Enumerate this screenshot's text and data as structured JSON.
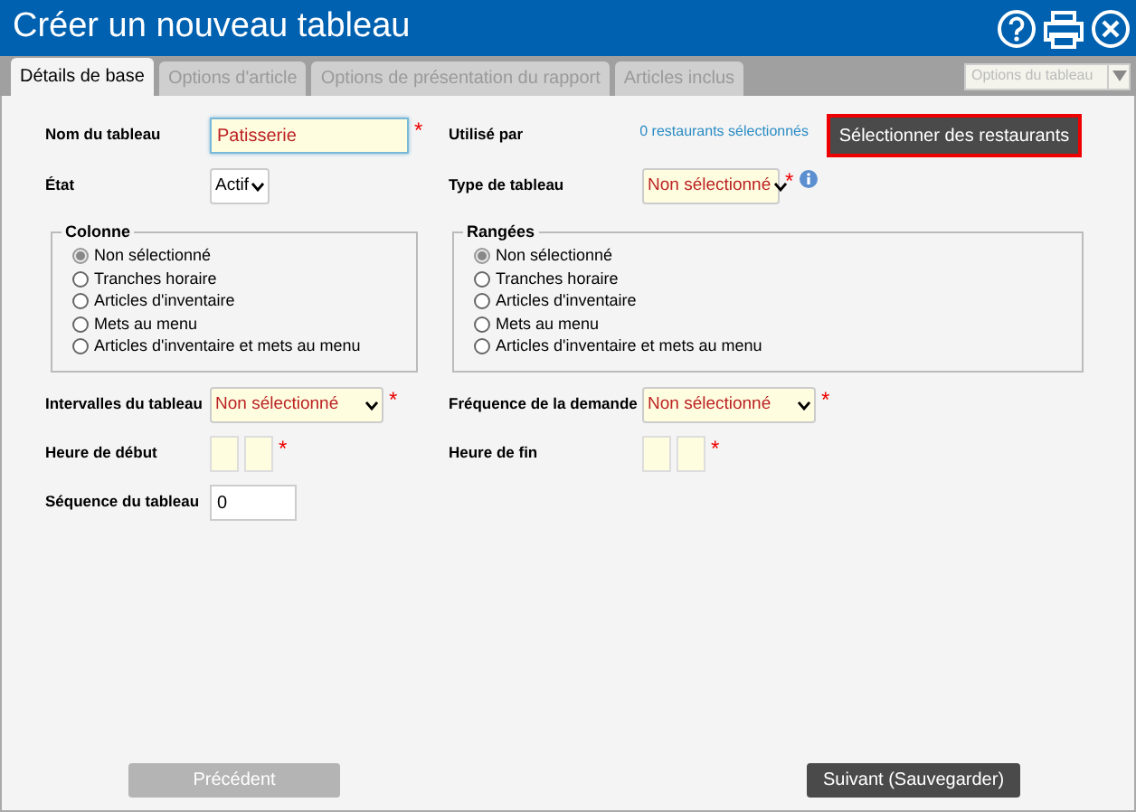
{
  "window": {
    "title": "Créer un nouveau tableau"
  },
  "tabs": [
    {
      "label": "Détails de base",
      "selected": true
    },
    {
      "label": "Options d'article",
      "selected": false
    },
    {
      "label": "Options de présentation du rapport",
      "selected": false
    },
    {
      "label": "Articles inclus",
      "selected": false
    }
  ],
  "tab_dropdown": {
    "value": "Options du tableau",
    "disabled": true
  },
  "top_rows": [
    {
      "left": {
        "label": "Nom du tableau",
        "kind": "text",
        "value": "Patisserie",
        "highlighted": true,
        "required_mark": "*"
      },
      "right": {
        "label": "Utilisé par",
        "kind": "link_button",
        "link": "0 restaurants sélectionnés",
        "button": "Sélectionner des restaurants"
      }
    },
    {
      "left": {
        "label": "État",
        "kind": "select",
        "value": "Actif",
        "highlighted": false
      },
      "right": {
        "label": "Type de tableau",
        "kind": "select",
        "value": "Non sélectionné",
        "highlighted": true,
        "required_mark": "*",
        "info": true
      }
    }
  ],
  "groups": [
    {
      "legend": "Colonne",
      "options": [
        {
          "label": "Non sélectionné",
          "selected": true
        },
        {
          "label": "Tranches horaire",
          "selected": false
        },
        {
          "label": "Articles d'inventaire",
          "selected": false
        },
        {
          "label": "Mets au menu",
          "selected": false
        },
        {
          "label": "Articles d'inventaire et mets au menu",
          "selected": false
        }
      ]
    },
    {
      "legend": "Rangées",
      "options": [
        {
          "label": "Non sélectionné",
          "selected": true
        },
        {
          "label": "Tranches horaire",
          "selected": false
        },
        {
          "label": "Articles d'inventaire",
          "selected": false
        },
        {
          "label": "Mets au menu",
          "selected": false
        },
        {
          "label": "Articles d'inventaire et mets au menu",
          "selected": false
        }
      ]
    }
  ],
  "bottom_rows": [
    {
      "left": {
        "label": "Intervalles du tableau",
        "kind": "select",
        "value": "Non sélectionné",
        "highlighted": true,
        "required_mark": "*"
      },
      "right": {
        "label": "Fréquence de la demande",
        "kind": "select",
        "value": "Non sélectionné",
        "highlighted": true,
        "required_mark": "*"
      }
    },
    {
      "left": {
        "label": "Heure de début",
        "kind": "time",
        "highlighted": true,
        "required_mark": "*"
      },
      "right": {
        "label": "Heure de fin",
        "kind": "time",
        "highlighted": true,
        "required_mark": "*"
      }
    },
    {
      "left": {
        "label": "Séquence du tableau",
        "kind": "number",
        "value": "0",
        "highlighted": false
      }
    }
  ],
  "footer": {
    "previous": {
      "label": "Précédent",
      "disabled": true
    },
    "next": {
      "label": "Suivant (Sauvegarder)",
      "disabled": false
    }
  }
}
